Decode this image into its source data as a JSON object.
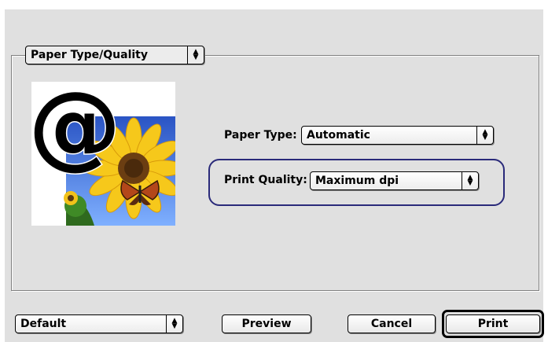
{
  "panel_selector": {
    "value": "Paper Type/Quality"
  },
  "paper_type": {
    "label": "Paper Type:",
    "value": "Automatic"
  },
  "print_quality": {
    "label": "Print Quality:",
    "value": "Maximum dpi"
  },
  "presets": {
    "value": "Default"
  },
  "buttons": {
    "preview": "Preview",
    "cancel": "Cancel",
    "print": "Print"
  },
  "preview_icon": {
    "glyph": "@",
    "name": "sunflower-butterfly-photo"
  },
  "colors": {
    "dialog_bg": "#e0e0e0",
    "highlight_border": "#2a2a7a"
  }
}
